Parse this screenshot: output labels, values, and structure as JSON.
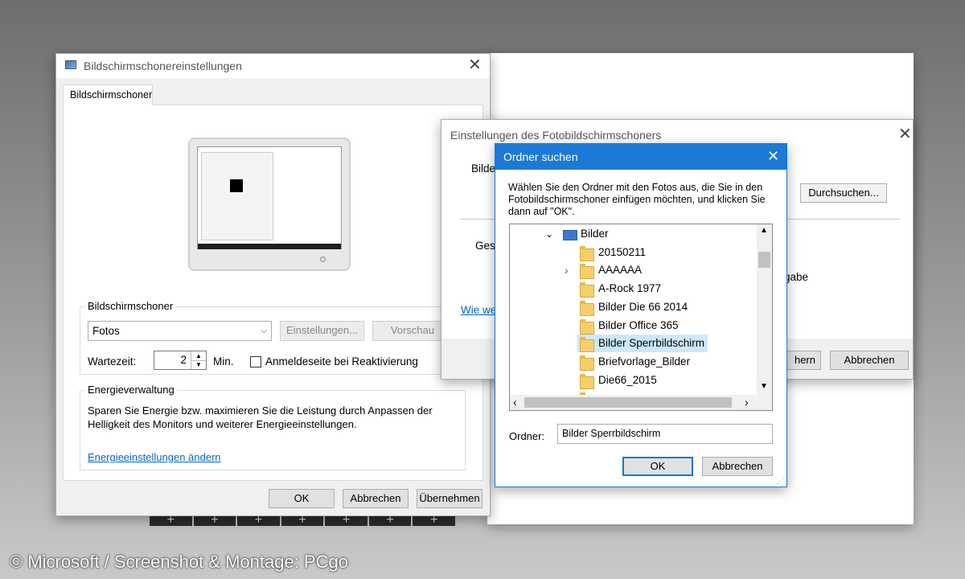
{
  "main_dialog": {
    "title": "Bildschirmschonereinstellungen",
    "tab": "Bildschirmschoner",
    "group_label": "Bildschirmschoner",
    "dropdown_value": "Fotos",
    "settings_button": "Einstellungen...",
    "preview_button": "Vorschau",
    "wait_label": "Wartezeit:",
    "wait_value": "2",
    "wait_unit": "Min.",
    "logon_checkbox_label": "Anmeldeseite bei Reaktivierung",
    "energy_group_label": "Energieverwaltung",
    "energy_text_1": "Sparen Sie Energie bzw. maximieren Sie die Leistung durch Anpassen der",
    "energy_text_2": "Helligkeit des Monitors und weiterer Energieeinstellungen.",
    "energy_link": "Energieeinstellungen ändern",
    "ok": "OK",
    "cancel": "Abbrechen",
    "apply": "Übernehmen"
  },
  "photo_dialog": {
    "title": "Einstellungen des Fotobildschirmschoners",
    "label_partial_1": "Bilde",
    "browse_button": "Durchsuchen...",
    "label_partial_2": "Ges",
    "label_partial_3": "gabe",
    "link_partial": "Wie we",
    "save_partial": "hern",
    "cancel": "Abbrechen"
  },
  "folder_dialog": {
    "title": "Ordner suchen",
    "instruction_1": "Wählen Sie den Ordner mit den Fotos aus, die Sie in den",
    "instruction_2": "Fotobildschirmschoner einfügen möchten, und klicken Sie",
    "instruction_3": "dann auf \"OK\".",
    "tree_root": "Bilder",
    "tree_items": [
      "20150211",
      "AAAAAA",
      "A-Rock 1977",
      "Bilder Die 66 2014",
      "Bilder Office 365",
      "Bilder Sperrbildschirm",
      "Briefvorlage_Bilder",
      "Die66_2015"
    ],
    "selected_index": 5,
    "folder_label": "Ordner:",
    "folder_value": "Bilder Sperrbildschirm",
    "ok": "OK",
    "cancel": "Abbrechen"
  },
  "caption": "© Microsoft / Screenshot & Montage: PCgo",
  "colors": {
    "accent": "#0078d7",
    "selection": "#cce8ff",
    "link": "#0066cc"
  }
}
